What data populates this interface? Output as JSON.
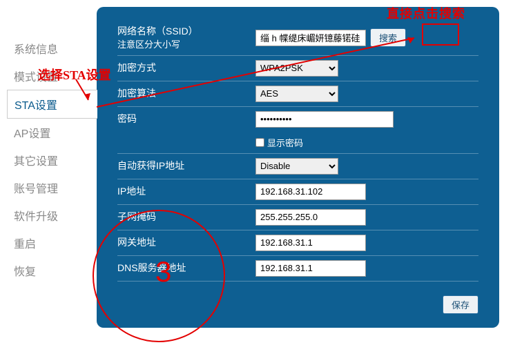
{
  "sidebar": {
    "items": [
      {
        "label": "系统信息"
      },
      {
        "label": "模式设置"
      },
      {
        "label": "STA设置"
      },
      {
        "label": "AP设置"
      },
      {
        "label": "其它设置"
      },
      {
        "label": "账号管理"
      },
      {
        "label": "软件升级"
      },
      {
        "label": "重启"
      },
      {
        "label": "恢复"
      }
    ],
    "activeIndex": 2
  },
  "form": {
    "ssid_label1": "网络名称（SSID）",
    "ssid_label2": "注意区分大小写",
    "ssid_value": "缁 h 幉缇床嵋妍镱藤锘硅",
    "search_btn": "搜索",
    "enc_method_label": "加密方式",
    "enc_method_value": "WPA2PSK",
    "enc_algo_label": "加密算法",
    "enc_algo_value": "AES",
    "password_label": "密码",
    "password_value": "••••••••••",
    "show_password_label": "显示密码",
    "auto_ip_label": "自动获得IP地址",
    "auto_ip_value": "Disable",
    "ip_label": "IP地址",
    "ip_value": "192.168.31.102",
    "mask_label": "子网掩码",
    "mask_value": "255.255.255.0",
    "gateway_label": "网关地址",
    "gateway_value": "192.168.31.1",
    "dns_label": "DNS服务器地址",
    "dns_value": "192.168.31.1",
    "save_btn": "保存"
  },
  "annotations": {
    "top": "直接点击搜索",
    "side": "选择STA设置",
    "number": "3"
  }
}
